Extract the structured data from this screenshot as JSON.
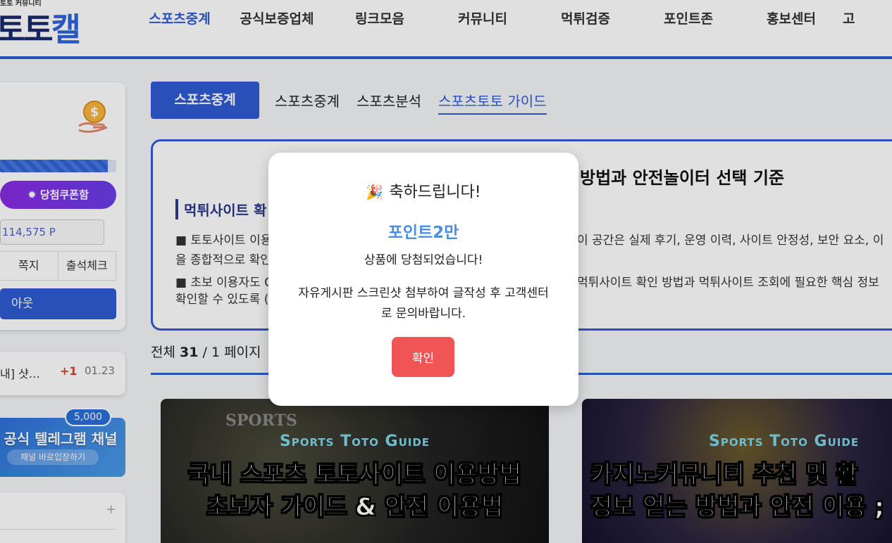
{
  "header": {
    "logo_small": "토토 커뮤니티",
    "logo_main": "토토",
    "logo_accent": "캘",
    "nav": [
      "스포츠중계",
      "공식보증업체",
      "링크모음",
      "커뮤니티",
      "먹튀검증",
      "포인트존",
      "홍보센터",
      "고"
    ]
  },
  "sidebar": {
    "progress_percent": 93,
    "coupon_label": "✹ 당첨쿠폰함",
    "points": "114,575 P",
    "links": [
      "쪽지",
      "출석체크"
    ],
    "logout_label": "아웃",
    "post": {
      "title": "내] 샷…",
      "count": "+1",
      "date": "01.23"
    },
    "telegram": {
      "badge": "5,000",
      "title": "캘 공식 텔레그램 채널",
      "sub": "채널 바로입장하기"
    }
  },
  "main": {
    "subnav_active": "스포츠중계",
    "subnav": [
      "스포츠중계",
      "스포츠분석",
      "스포츠토토 가이드"
    ],
    "info": {
      "title": "방법과 안전놀이터 선택 기준",
      "subtitle": "먹튀사이트 확",
      "line1_left": "■ 토토사이트 이용",
      "line1_right": "이 공간은 실제 후기, 운영 이력, 사이트 안정성, 보안 요소, 이",
      "line2_left": "을 종합적으로 확인",
      "line3_left": "■ 초보 이용자도 C",
      "line3_right": "먹튀사이트 확인 방법과 먹튀사이트 조회에 필요한 핵심 정보",
      "line4_left": "확인할 수 있도록 ("
    },
    "count": {
      "prefix": "전체 ",
      "total": "31",
      "sep": " / ",
      "pages": "1 페이지"
    },
    "cards": [
      {
        "label": "Sports Toto Guide",
        "line1": "국내 스포츠 토토사이트 이용방법",
        "line2": "초보자 가이드 & 안전 이용법",
        "badge": "SPORTS"
      },
      {
        "label": "Sports Toto Guide",
        "line1": "카지노커뮤니티 추천 및 활",
        "line2": "정보 얻는 방법과 안전 이용 ;"
      }
    ]
  },
  "modal": {
    "emoji": "🎉",
    "title": "축하드립니다!",
    "prize": "포인트2만",
    "message": "상품에 당첨되었습니다!",
    "note": "자유게시판 스크린샷 첨부하여 글작성 후 고객센터로 문의바랍니다.",
    "confirm": "확인"
  }
}
